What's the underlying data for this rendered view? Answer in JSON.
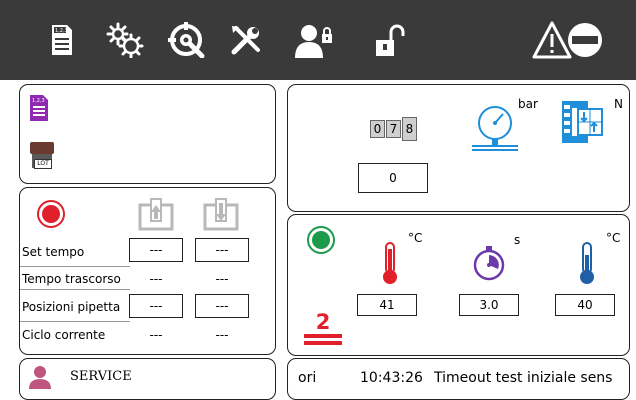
{
  "toolbar": {
    "icons": [
      "recipe-list-icon",
      "settings-gears-icon",
      "calibration-icon",
      "tools-icon",
      "user-lock-icon",
      "unlock-icon"
    ],
    "alarm_icon": "warning-stop-icon",
    "recipe_icon_text": "1,2,3"
  },
  "recipe_panel": {
    "recipe_icon": "recipe-icon",
    "recipe_icon_text": "1,2,3",
    "lot_icon": "lot-icon",
    "lot_label": "LOT"
  },
  "test_panel": {
    "rows": [
      {
        "label": "Set tempo",
        "val1": "---",
        "val2": "---",
        "boxed": true
      },
      {
        "label": "Tempo trascorso",
        "val1": "---",
        "val2": "---",
        "boxed": false
      },
      {
        "label": "Posizioni pipetta",
        "val1": "---",
        "val2": "---",
        "boxed": true
      },
      {
        "label": "Ciclo corrente",
        "val1": "---",
        "val2": "---",
        "boxed": false
      }
    ]
  },
  "pressure_panel": {
    "counter_digits": [
      "0",
      "7",
      "8"
    ],
    "counter_value": "0",
    "pressure_unit": "bar",
    "force_unit": "N"
  },
  "temperature_panel": {
    "temp1_unit": "°C",
    "timer_unit": "s",
    "temp2_unit": "°C",
    "temp1_value": "41",
    "timer_value": "3.0",
    "temp2_value": "40",
    "step_number": "2",
    "status_color": "#1a9a4a"
  },
  "footer": {
    "user_label": "SERVICE",
    "status_prefix": "ori",
    "status_time": "10:43:26",
    "status_message": "Timeout test iniziale sens"
  },
  "colors": {
    "toolbar_bg": "#3a3a3a",
    "accent_purple": "#8e2bb0",
    "record_red": "#e0202a",
    "gauge_blue": "#1e8fd8",
    "step_red": "#e0202a",
    "user_pink": "#c0567e"
  }
}
